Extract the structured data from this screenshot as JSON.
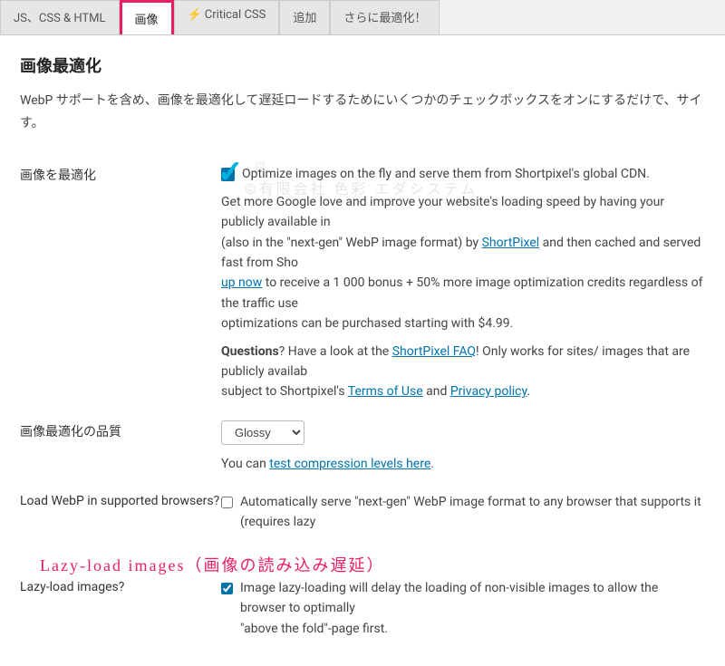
{
  "tabs": {
    "t0": "JS、CSS & HTML",
    "t1": "画像",
    "t2": "Critical CSS",
    "t3": "追加",
    "t4": "さらに最適化！"
  },
  "section": {
    "title": "画像最適化",
    "desc": "WebP サポートを含め、画像を最適化して遅延ロードするためにいくつかのチェックボックスをオンにするだけで、サイ\nす。"
  },
  "opt": {
    "label": "画像を最適化",
    "cb_label": "Optimize images on the fly and serve them from Shortpixel's global CDN.",
    "desc1_a": "Get more Google love and improve your website's loading speed by having your publicly available in",
    "desc1_b": "(also in the \"next-gen\" WebP image format) by ",
    "link_sp": "ShortPixel",
    "desc1_c": " and then cached and served fast from Sho",
    "link_signup": "up now",
    "desc1_d": " to receive a 1 000 bonus + 50% more image optimization credits regardless of the traffic use",
    "desc1_e": "optimizations can be purchased starting with $4.99.",
    "q_bold": "Questions",
    "q_a": "? Have a look at the ",
    "link_faq": "ShortPixel FAQ",
    "q_b": "! Only works for sites/ images that are publicly availab",
    "q_c": "subject to Shortpixel's ",
    "link_tou": "Terms of Use",
    "q_and": " and ",
    "link_pp": "Privacy policy"
  },
  "quality": {
    "label": "画像最適化の品質",
    "select": "Glossy",
    "hint_a": "You can ",
    "link_test": "test compression levels here",
    "hint_b": "."
  },
  "webp": {
    "label": "Load WebP in supported browsers?",
    "cb_label": "Automatically serve \"next-gen\" WebP image format to any browser that supports it (requires lazy"
  },
  "lazy": {
    "annotation": "Lazy-load images（画像の読み込み遅延）",
    "label": "Lazy-load images?",
    "cb_label": "Image lazy-loading will delay the loading of non-visible images to allow the browser to optimally",
    "cb_label2": "\"above the fold\"-page first."
  },
  "watermark": "©有限会社 色彩",
  "watermark2": "エダシステム",
  "wm3": "貝"
}
